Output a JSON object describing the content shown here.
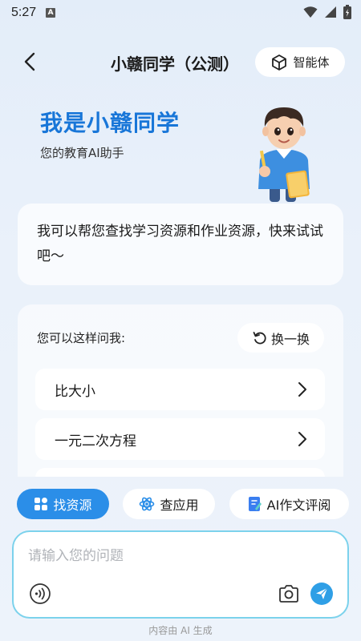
{
  "status_bar": {
    "time": "5:27",
    "notification_letter": "A"
  },
  "header": {
    "title": "小赣同学（公测）",
    "agent_label": "智能体"
  },
  "hero": {
    "title": "我是小赣同学",
    "subtitle": "您的教育AI助手"
  },
  "intro": {
    "text": "我可以帮您查找学习资源和作业资源，快来试试吧～"
  },
  "suggestions": {
    "label": "您可以这样问我:",
    "refresh_label": "换一换",
    "items": [
      {
        "label": "比大小"
      },
      {
        "label": "一元二次方程"
      },
      {
        "label": ""
      }
    ]
  },
  "chips": [
    {
      "label": "找资源",
      "icon": "grid-icon",
      "active": true
    },
    {
      "label": "查应用",
      "icon": "atom-icon",
      "active": false
    },
    {
      "label": "AI作文评阅",
      "icon": "document-pen-icon",
      "active": false
    }
  ],
  "input": {
    "placeholder": "请输入您的问题",
    "value": ""
  },
  "footer": {
    "note": "内容由 AI 生成"
  },
  "colors": {
    "accent": "#2b8ee8",
    "hero_title": "#1876d8",
    "input_border": "#7cd2ec",
    "send": "#2f9fe6"
  }
}
